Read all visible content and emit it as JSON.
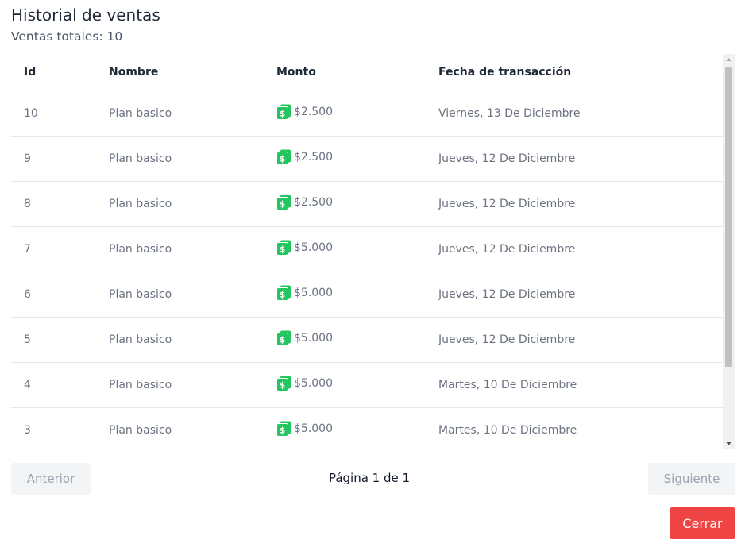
{
  "header": {
    "title": "Historial de ventas",
    "total_label": "Ventas totales: 10"
  },
  "table": {
    "columns": [
      "Id",
      "Nombre",
      "Monto",
      "Fecha de transacción"
    ],
    "rows": [
      {
        "id": "10",
        "name": "Plan basico",
        "amount": "$2.500",
        "date": "Viernes, 13 De Diciembre"
      },
      {
        "id": "9",
        "name": "Plan basico",
        "amount": "$2.500",
        "date": "Jueves, 12 De Diciembre"
      },
      {
        "id": "8",
        "name": "Plan basico",
        "amount": "$2.500",
        "date": "Jueves, 12 De Diciembre"
      },
      {
        "id": "7",
        "name": "Plan basico",
        "amount": "$5.000",
        "date": "Jueves, 12 De Diciembre"
      },
      {
        "id": "6",
        "name": "Plan basico",
        "amount": "$5.000",
        "date": "Jueves, 12 De Diciembre"
      },
      {
        "id": "5",
        "name": "Plan basico",
        "amount": "$5.000",
        "date": "Jueves, 12 De Diciembre"
      },
      {
        "id": "4",
        "name": "Plan basico",
        "amount": "$5.000",
        "date": "Martes, 10 De Diciembre"
      },
      {
        "id": "3",
        "name": "Plan basico",
        "amount": "$5.000",
        "date": "Martes, 10 De Diciembre"
      }
    ],
    "amount_icon": "money-icon",
    "amount_icon_color": "#22c55e"
  },
  "pagination": {
    "prev_label": "Anterior",
    "next_label": "Siguiente",
    "page_text": "Página 1 de 1"
  },
  "footer": {
    "close_label": "Cerrar",
    "close_color": "#ef4444"
  }
}
